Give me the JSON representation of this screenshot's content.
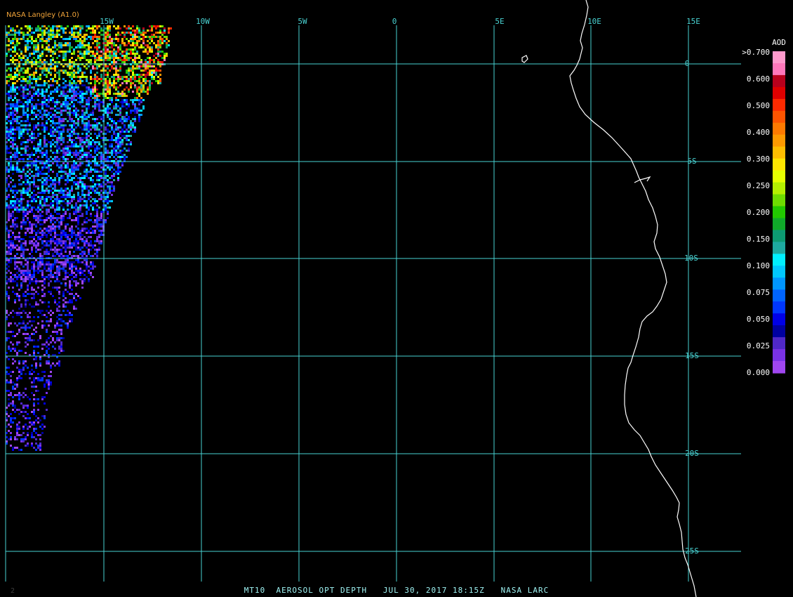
{
  "producer_label": "NASA Langley (A1.0)",
  "footer": {
    "caption": "MT10  AEROSOL OPT DEPTH   JUL 30, 2017 18:15Z   NASA LARC",
    "corner_mark": "2"
  },
  "map": {
    "longitude_labels": [
      "15W",
      "10W",
      "5W",
      "0",
      "5E",
      "10E",
      "15E"
    ],
    "latitude_labels": [
      "0",
      "5S",
      "10S",
      "15S",
      "20S",
      "25S"
    ],
    "colors": {
      "grid": "#49d2d2",
      "coastline": "#ffffff",
      "background": "#000000"
    }
  },
  "legend": {
    "title": "AOD",
    "tick_labels": [
      ">0.700",
      "0.600",
      "0.500",
      "0.400",
      "0.300",
      "0.250",
      "0.200",
      "0.150",
      "0.100",
      "0.075",
      "0.050",
      "0.025",
      "0.000"
    ],
    "colors": [
      "#ff99cc",
      "#ff77bb",
      "#b8001c",
      "#e00000",
      "#ff2a00",
      "#ff5500",
      "#ff7a00",
      "#ff9a00",
      "#ffbe00",
      "#ffe600",
      "#e6ff00",
      "#b4f000",
      "#6edc00",
      "#22c800",
      "#10aa2a",
      "#0d9a72",
      "#1eaaa0",
      "#00f0ff",
      "#00c8ff",
      "#0096ff",
      "#0064ff",
      "#0037ff",
      "#0000e6",
      "#0000a0",
      "#5028c8",
      "#7a32e6",
      "#a046f0"
    ]
  }
}
